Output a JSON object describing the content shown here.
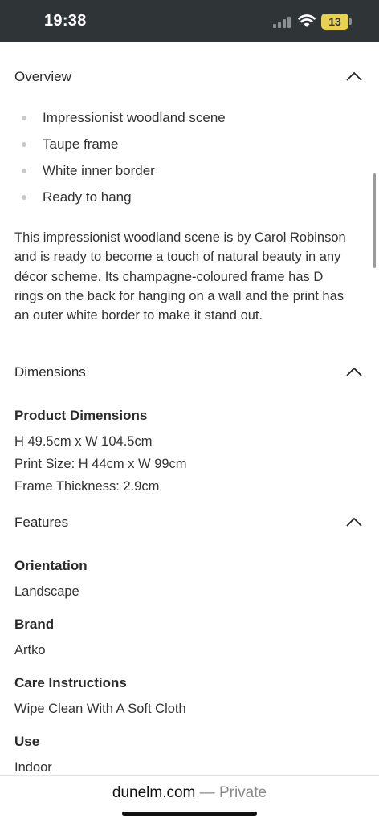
{
  "status_bar": {
    "time": "19:38",
    "battery": "13"
  },
  "sections": {
    "overview": {
      "title": "Overview",
      "bullets": [
        "Impressionist woodland scene",
        "Taupe frame",
        "White inner border",
        "Ready to hang"
      ],
      "description": "This impressionist woodland scene is by Carol Robinson and is ready to become a touch of natural beauty in any décor scheme. Its champagne-coloured frame has D rings on the back for hanging on a wall and the print has an outer white border to make it stand out."
    },
    "dimensions": {
      "title": "Dimensions",
      "heading": "Product Dimensions",
      "lines": [
        "H 49.5cm x W 104.5cm",
        "Print Size: H 44cm x W 99cm",
        "Frame Thickness: 2.9cm"
      ]
    },
    "features": {
      "title": "Features",
      "items": [
        {
          "label": "Orientation",
          "value": "Landscape"
        },
        {
          "label": "Brand",
          "value": "Artko"
        },
        {
          "label": "Care Instructions",
          "value": "Wipe Clean With A Soft Cloth"
        },
        {
          "label": "Use",
          "value": "Indoor"
        }
      ]
    }
  },
  "browser": {
    "domain": "dunelm.com",
    "separator": " — ",
    "mode": "Private"
  },
  "icons": {
    "section_toggle": "chevron-up-icon",
    "signal": "cellular-signal-icon",
    "wifi": "wifi-icon",
    "battery": "battery-icon"
  },
  "colors": {
    "status_bar_bg": "#2f3437",
    "battery_fill": "#e7d14f",
    "text": "#2b2b2b"
  }
}
